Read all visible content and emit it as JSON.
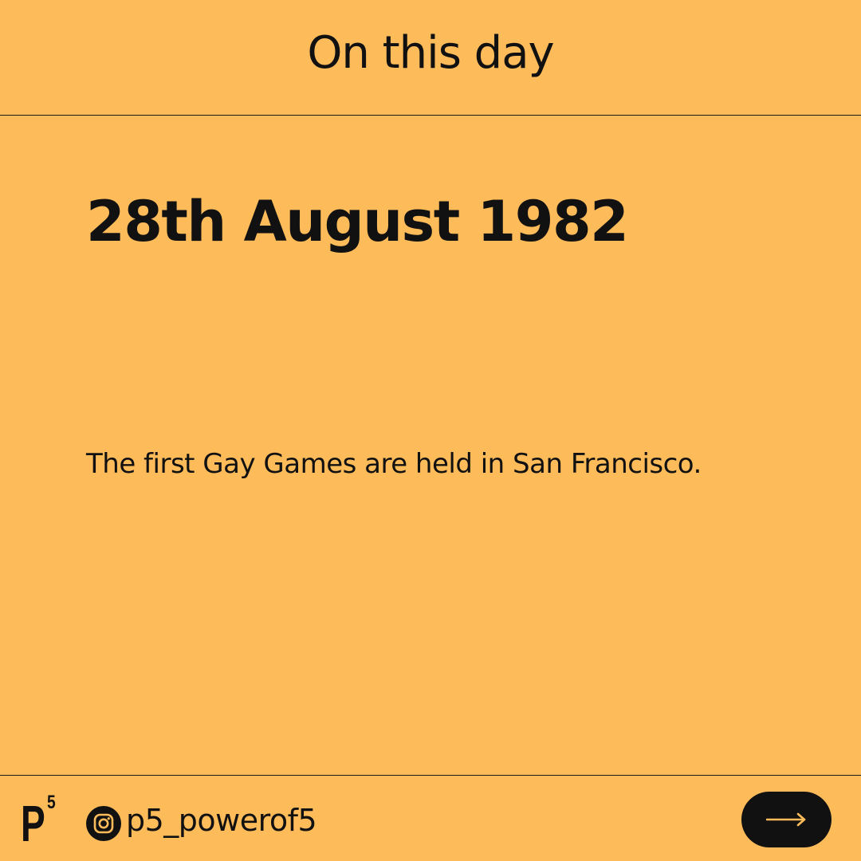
{
  "header": {
    "title": "On this day"
  },
  "main": {
    "date": "28th August 1982",
    "event": "The first Gay Games are held in San Francisco."
  },
  "footer": {
    "logo_letter": "P",
    "logo_superscript": "5",
    "logo_icon": "p5-logo",
    "social_icon": "instagram-icon",
    "handle": "p5_powerof5",
    "next_icon": "arrow-right-icon"
  },
  "colors": {
    "background": "#FDBB5A",
    "text": "#111111",
    "button": "#111111",
    "button_arrow": "#FDBB5A"
  }
}
